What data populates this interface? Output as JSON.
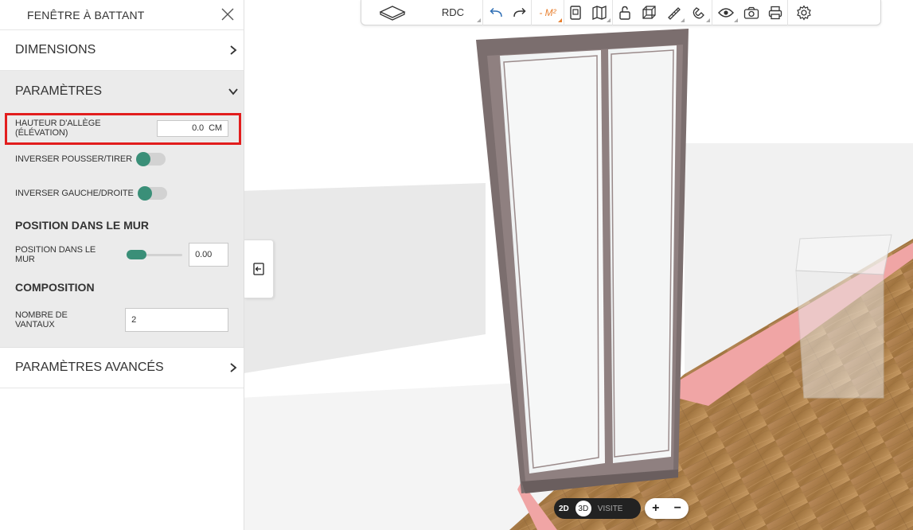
{
  "panel": {
    "title": "FENÊTRE À BATTANT",
    "sections": {
      "dimensions": "DIMENSIONS",
      "parametres": "PARAMÈTRES",
      "avances": "PARAMÈTRES AVANCÉS"
    },
    "fields": {
      "hauteur_label": "HAUTEUR D'ALLÈGE (ÉLÉVATION)",
      "hauteur_value": "0.0",
      "hauteur_unit": "CM",
      "inverser_pousser_label": "INVERSER POUSSER/TIRER",
      "inverser_gauche_label": "INVERSER GAUCHE/DROITE",
      "position_heading": "POSITION DANS LE MUR",
      "position_label": "POSITION DANS LE MUR",
      "position_value": "0.00",
      "composition_heading": "COMPOSITION",
      "vantaux_label": "NOMBRE DE VANTAUX",
      "vantaux_value": "2"
    },
    "toggles": {
      "inverser_pousser": true,
      "inverser_gauche": true
    },
    "slider_fraction": 0.0
  },
  "toolbar": {
    "level": "RDC",
    "measure": "- M²",
    "icons": [
      "floor-plan-icon",
      "undo-icon",
      "redo-icon",
      "document-icon",
      "map-icon",
      "lock-icon",
      "cube-icon",
      "ruler-icon",
      "magnet-icon",
      "eye-icon",
      "camera-icon",
      "print-icon",
      "settings-icon"
    ]
  },
  "view": {
    "mode_2d": "2D",
    "mode_3d": "3D",
    "mode_visite": "VISITE",
    "zoom_in": "+",
    "zoom_out": "−"
  },
  "colors": {
    "accent": "#3a8f78",
    "highlight": "#e21d1d",
    "toolbar_blue": "#2f6fb5",
    "orange": "#e87f2e"
  }
}
